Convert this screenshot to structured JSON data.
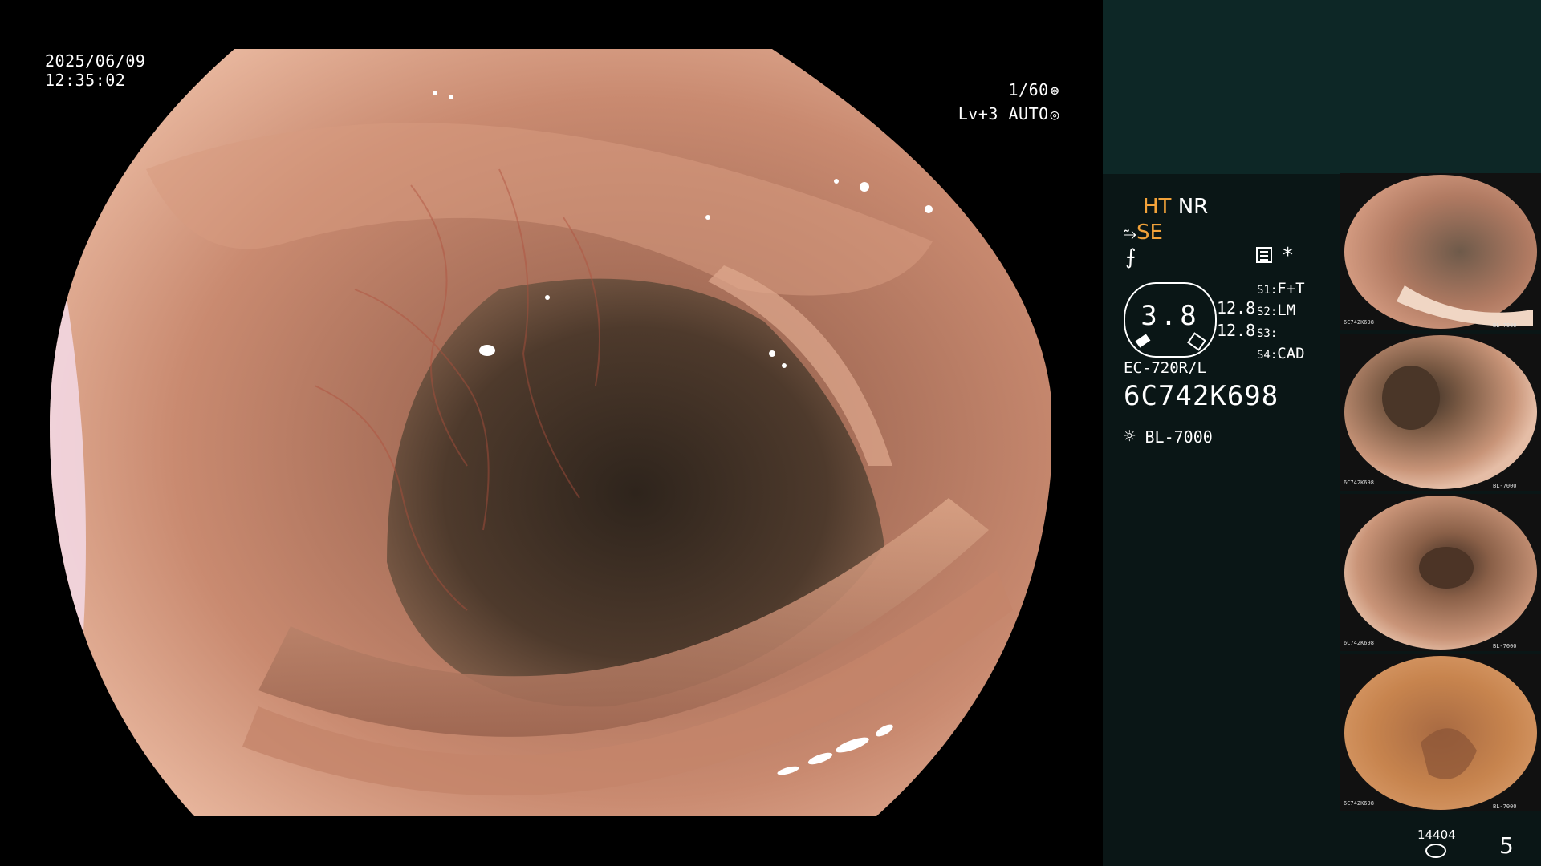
{
  "overlay": {
    "date": "2025/06/09",
    "time": "12:35:02",
    "shutter": "1/60",
    "level": "Lv+3",
    "exposure": "AUTO"
  },
  "panel": {
    "mode_ht": "HT",
    "mode_nr": "NR",
    "mode_se": "SE",
    "star": "*",
    "dial_value": "3.8",
    "dial_side_1": "12.8",
    "dial_side_2": "12.8",
    "switches": [
      {
        "key": "S1:",
        "value": "F+T"
      },
      {
        "key": "S2:",
        "value": "LM"
      },
      {
        "key": "S3:",
        "value": ""
      },
      {
        "key": "S4:",
        "value": "CAD"
      }
    ],
    "scope_model": "EC-720R/L",
    "scope_serial": "6C742K698",
    "light_source": "BL-7000",
    "counter": "14404",
    "page_number": "5"
  },
  "thumbnails": [
    {
      "serial": "6C742K698",
      "light": "BL-7000"
    },
    {
      "serial": "6C742K698",
      "light": "BL-7000"
    },
    {
      "serial": "6C742K698",
      "light": "BL-7000"
    },
    {
      "serial": "6C742K698",
      "light": "BL-7000"
    }
  ],
  "colors": {
    "panel_top": "#0d2726",
    "panel_bottom": "#0a1616",
    "accent_orange": "#f2a23a"
  }
}
